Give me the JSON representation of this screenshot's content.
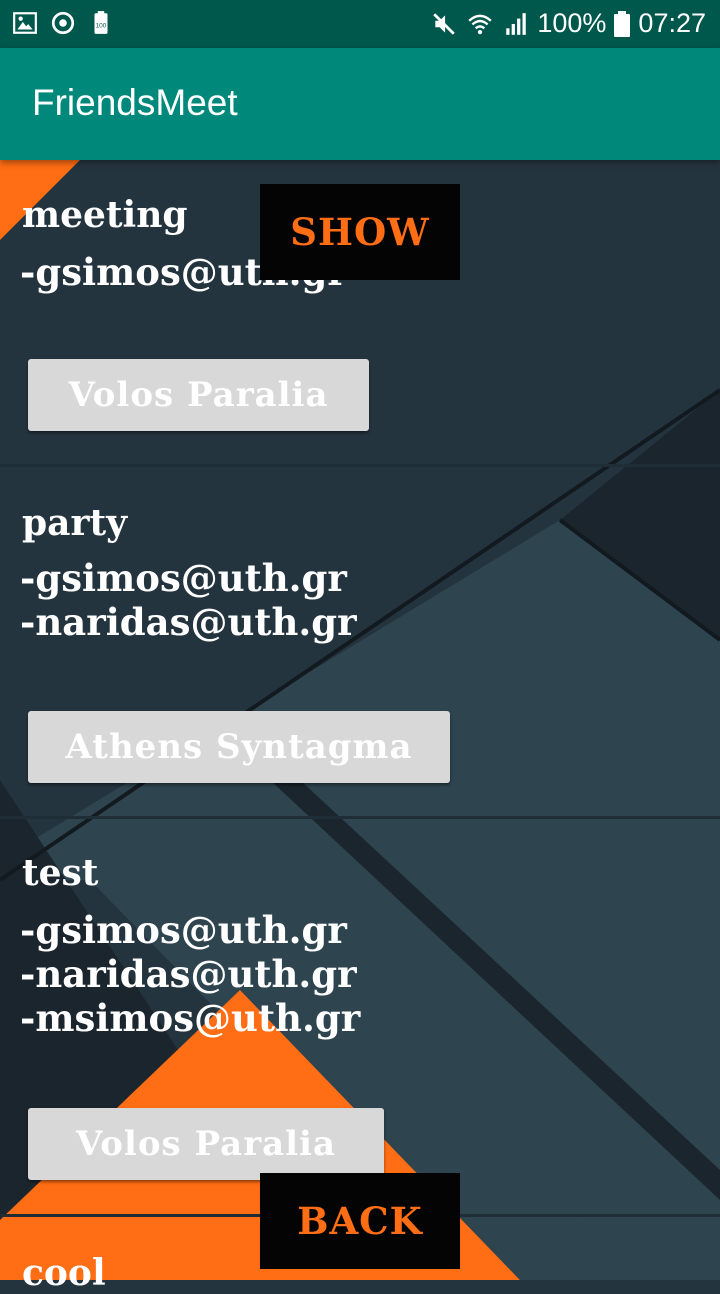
{
  "status_bar": {
    "left_icons": [
      "image-icon",
      "sync-icon",
      "battery-saver-icon"
    ],
    "battery_percent": "100%",
    "time": "07:27"
  },
  "app_bar": {
    "title": "FriendsMeet"
  },
  "meetings": [
    {
      "title": "meeting",
      "participants": [
        "-gsimos@uth.gr"
      ],
      "location": "Volos Paralia"
    },
    {
      "title": "party",
      "participants": [
        "-gsimos@uth.gr",
        "-naridas@uth.gr"
      ],
      "location": "Athens Syntagma"
    },
    {
      "title": "test",
      "participants": [
        "-gsimos@uth.gr",
        "-naridas@uth.gr",
        "-msimos@uth.gr"
      ],
      "location": "Volos Paralia"
    },
    {
      "title": "cool",
      "participants": [],
      "location": ""
    }
  ],
  "buttons": {
    "show": "SHOW",
    "back": "BACK"
  },
  "colors": {
    "status_bar": "#00574b",
    "app_bar": "#00897b",
    "accent": "#ff6d14",
    "background": "#24343f"
  }
}
